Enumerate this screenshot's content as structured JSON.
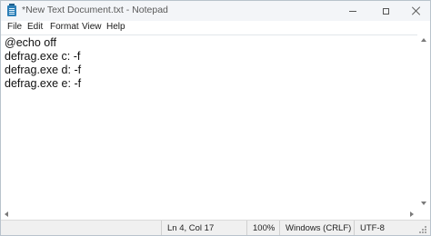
{
  "window": {
    "title": "*New Text Document.txt - Notepad",
    "icon": "notepad-icon"
  },
  "menu": {
    "items": [
      "File",
      "Edit",
      "Format",
      "View",
      "Help"
    ]
  },
  "editor": {
    "lines": [
      "@echo off",
      "defrag.exe c: -f",
      "defrag.exe d: -f",
      "defrag.exe e: -f"
    ]
  },
  "status": {
    "position": "Ln 4, Col 17",
    "zoom": "100%",
    "line_ending": "Windows (CRLF)",
    "encoding": "UTF-8"
  },
  "colors": {
    "titlebar": "#f3f5f8",
    "editor_bg": "#ffffff",
    "statusbar": "#f0f0f0",
    "app_icon": "#2d7fb7"
  }
}
